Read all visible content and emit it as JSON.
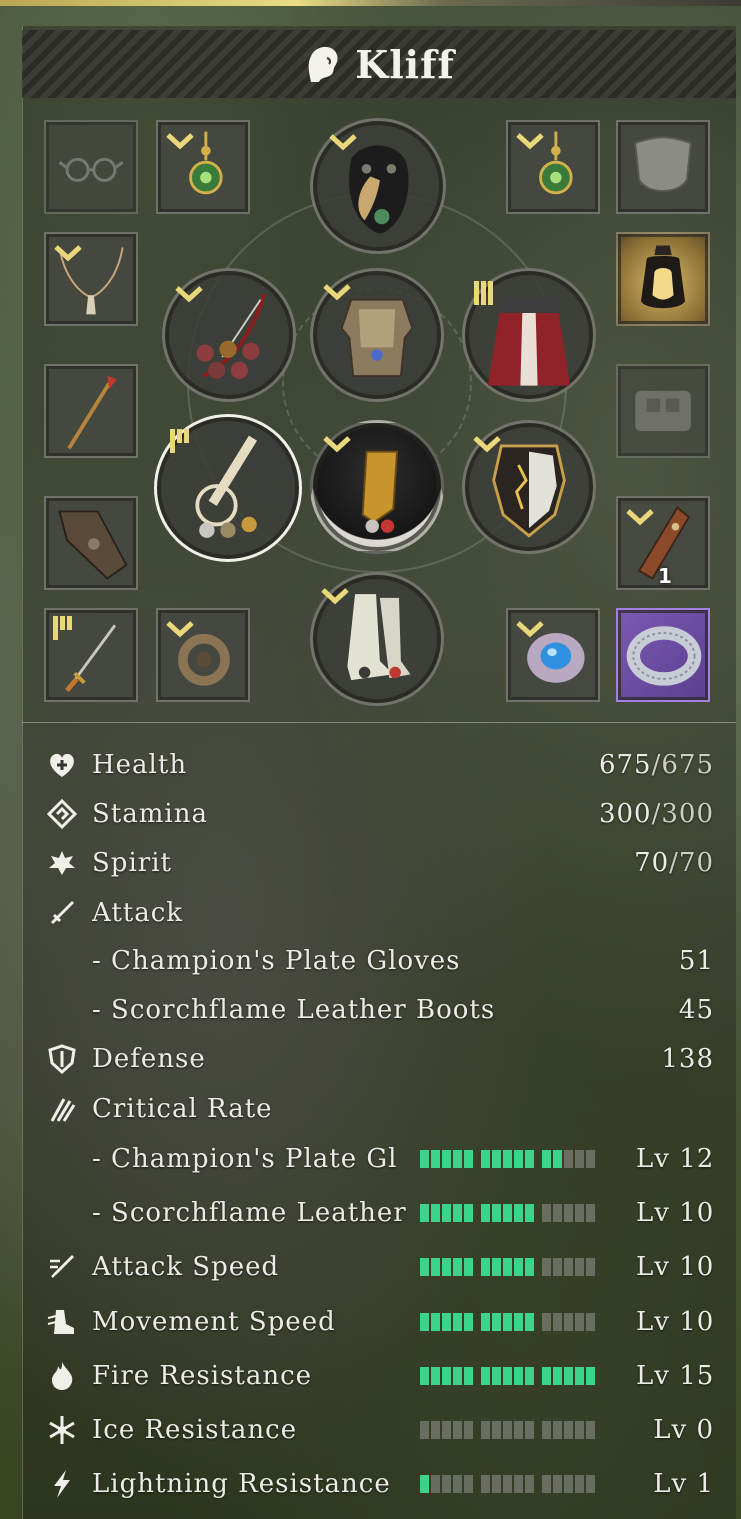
{
  "character": {
    "name": "Kliff"
  },
  "equipment": {
    "slots": [
      {
        "id": "glasses",
        "empty": true
      },
      {
        "id": "earring-left",
        "marker": "chevron"
      },
      {
        "id": "helmet",
        "marker": "chevron"
      },
      {
        "id": "earring-right",
        "marker": "chevron"
      },
      {
        "id": "face-mask",
        "empty": true
      },
      {
        "id": "necklace",
        "marker": "chevron"
      },
      {
        "id": "lantern",
        "highlight": "gold"
      },
      {
        "id": "bow",
        "marker": "chevron"
      },
      {
        "id": "chest-armor",
        "marker": "chevron"
      },
      {
        "id": "cloak",
        "marker": "bars"
      },
      {
        "id": "spear"
      },
      {
        "id": "belt",
        "empty": true
      },
      {
        "id": "main-weapon",
        "marker": "bars"
      },
      {
        "id": "gloves",
        "marker": "chevron"
      },
      {
        "id": "shield",
        "marker": "chevron"
      },
      {
        "id": "gauntlet-left"
      },
      {
        "id": "throwing-item",
        "marker": "chevron",
        "count": "1"
      },
      {
        "id": "dagger",
        "marker": "bars"
      },
      {
        "id": "ring-left",
        "marker": "chevron"
      },
      {
        "id": "boots",
        "marker": "chevron"
      },
      {
        "id": "ring-right",
        "marker": "chevron"
      },
      {
        "id": "bracelet",
        "highlight": "purple"
      }
    ]
  },
  "stats": {
    "health": {
      "label": "Health",
      "current": "675",
      "max": "/675"
    },
    "stamina": {
      "label": "Stamina",
      "current": "300",
      "max": "/300"
    },
    "spirit": {
      "label": "Spirit",
      "current": "70",
      "max": "/70"
    },
    "attack": {
      "label": "Attack",
      "items": [
        {
          "label": "- Champion's Plate Gloves",
          "value": "51"
        },
        {
          "label": "- Scorchflame Leather Boots",
          "value": "45"
        }
      ]
    },
    "defense": {
      "label": "Defense",
      "value": "138"
    },
    "critical_rate": {
      "label": "Critical Rate",
      "items": [
        {
          "label": "- Champion's Plate Gl",
          "level": "Lv 12",
          "level_value": 12
        },
        {
          "label": "- Scorchflame Leather",
          "level": "Lv 10",
          "level_value": 10
        }
      ]
    },
    "attack_speed": {
      "label": "Attack Speed",
      "level": "Lv 10",
      "level_value": 10
    },
    "movement_speed": {
      "label": "Movement Speed",
      "level": "Lv 10",
      "level_value": 10
    },
    "fire_resistance": {
      "label": "Fire Resistance",
      "level": "Lv 15",
      "level_value": 15
    },
    "ice_resistance": {
      "label": "Ice Resistance",
      "level": "Lv 0",
      "level_value": 0
    },
    "lightning_resistance": {
      "label": "Lightning Resistance",
      "level": "Lv 1",
      "level_value": 1
    }
  },
  "gauge_max": 15,
  "colors": {
    "gauge_on": "#3bd48a",
    "chevron": "#e9d77a",
    "rare_purple": "#7b5ab3",
    "gold_highlight": "#d8b868"
  }
}
